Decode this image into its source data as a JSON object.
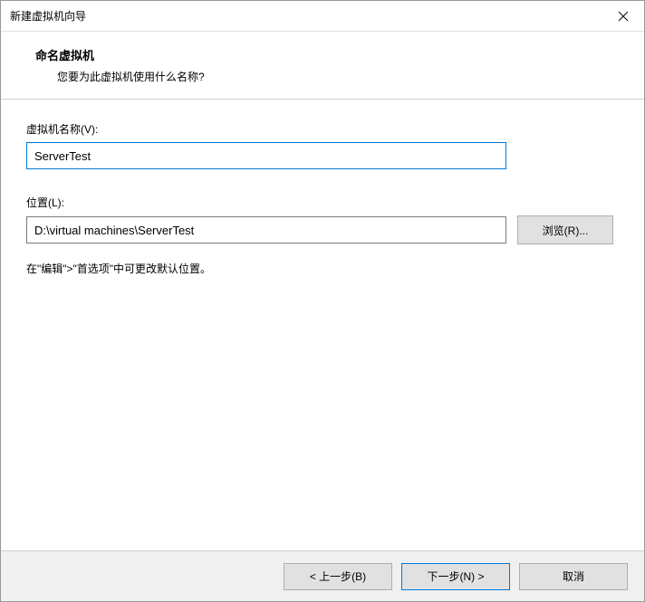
{
  "window": {
    "title": "新建虚拟机向导"
  },
  "header": {
    "title": "命名虚拟机",
    "subtitle": "您要为此虚拟机使用什么名称?"
  },
  "fields": {
    "name": {
      "label": "虚拟机名称(V):",
      "value": "ServerTest"
    },
    "location": {
      "label": "位置(L):",
      "value": "D:\\virtual machines\\ServerTest",
      "browse_label": "浏览(R)..."
    },
    "hint": "在\"编辑\">\"首选项\"中可更改默认位置。"
  },
  "footer": {
    "back_label": "< 上一步(B)",
    "next_label": "下一步(N) >",
    "cancel_label": "取消"
  }
}
